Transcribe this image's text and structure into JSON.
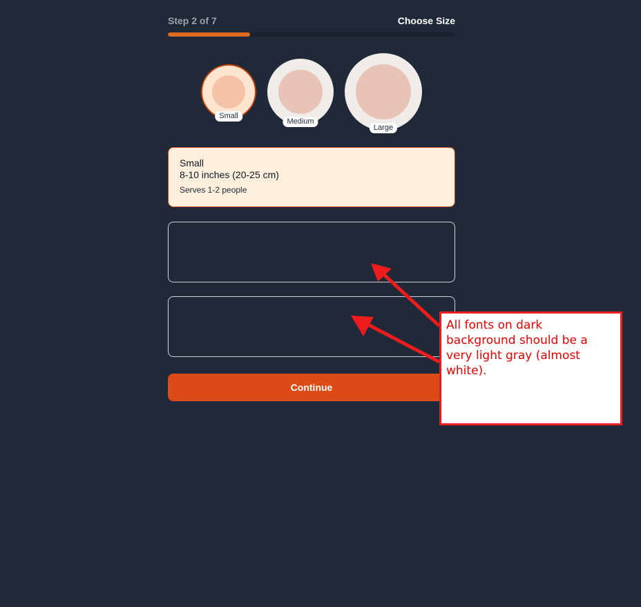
{
  "header": {
    "step_text": "Step 2 of 7",
    "title": "Choose Size"
  },
  "progress": {
    "current_step": 2,
    "total_steps": 7,
    "fill_color": "#dd6b20"
  },
  "sizes": [
    {
      "label": "Small",
      "selected": true
    },
    {
      "label": "Medium",
      "selected": false
    },
    {
      "label": "Large",
      "selected": false
    }
  ],
  "selected_size": {
    "name": "Small",
    "dimensions": "8-10 inches (20-25 cm)",
    "serves": "Serves 1-2 people"
  },
  "continue_label": "Continue",
  "annotation": {
    "text": "All fonts on dark background should be a very light gray (almost white).",
    "color": "#ee1c1c"
  },
  "colors": {
    "background": "#1f2937",
    "accent": "#dc4a16",
    "card_bg": "#feefdc"
  }
}
